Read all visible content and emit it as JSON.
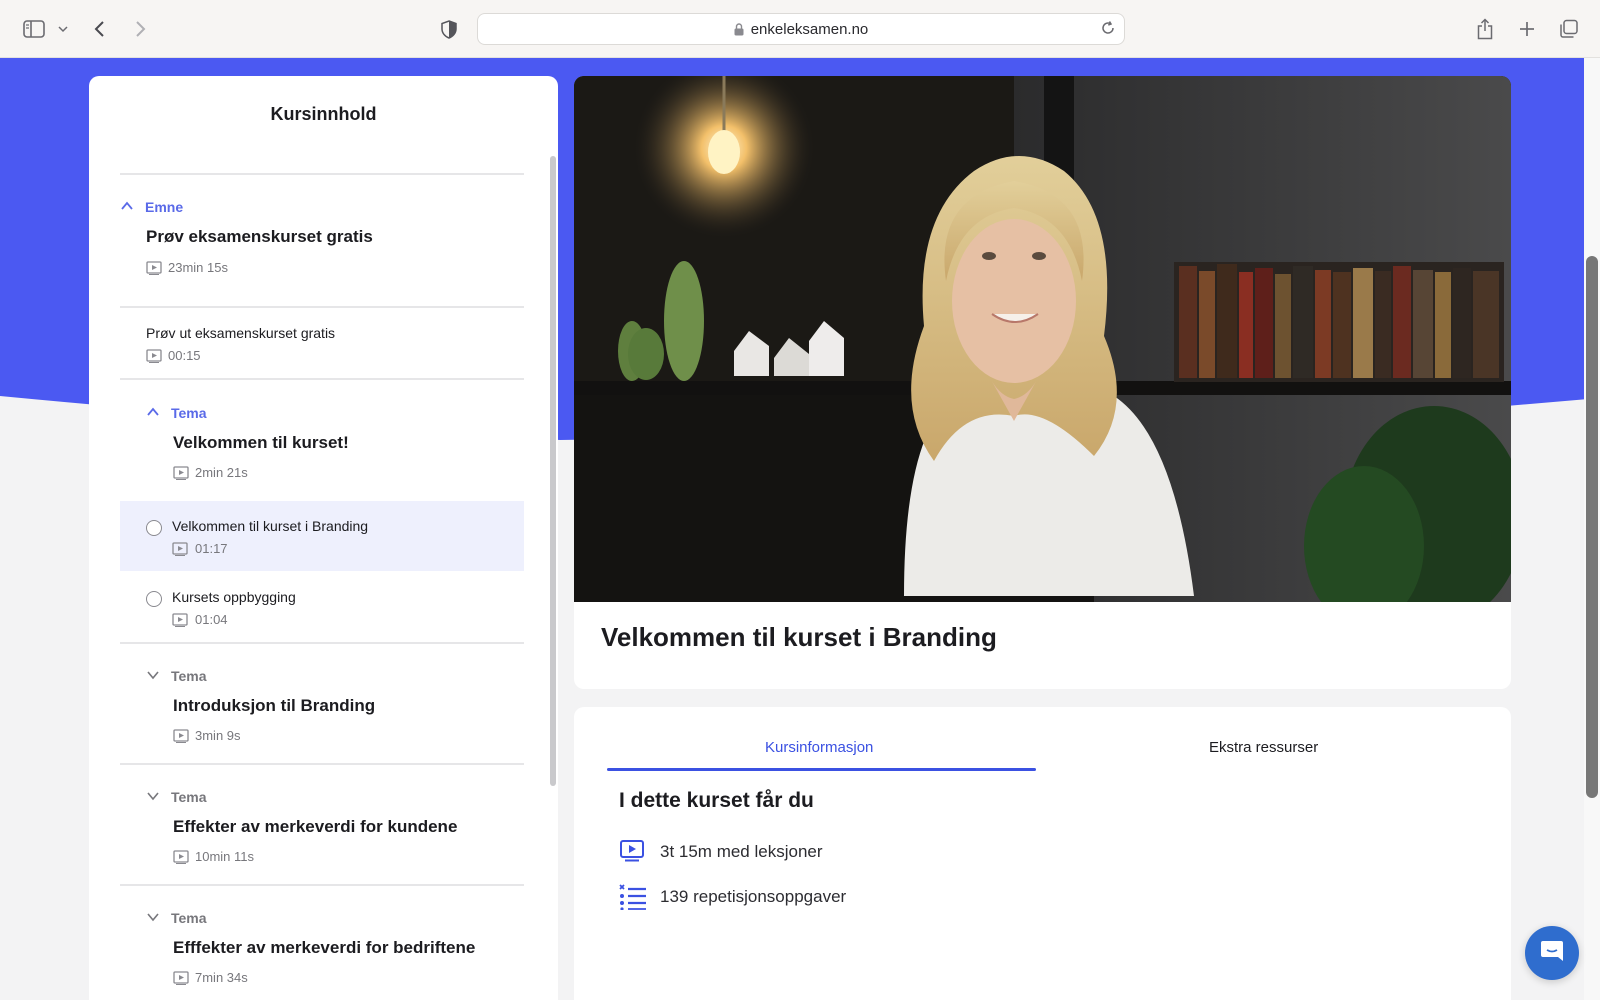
{
  "browser": {
    "url": "enkeleksamen.no",
    "icons": [
      "sidebar-icon",
      "chevron-down-icon",
      "back-icon",
      "forward-icon",
      "shield-icon",
      "lock-icon",
      "reload-icon",
      "share-icon",
      "new-tab-icon",
      "tabs-overview-icon"
    ]
  },
  "colors": {
    "brand_blue": "#4b59f2",
    "accent": "#3b51e2",
    "active_bg": "#eef0fd"
  },
  "sidebar": {
    "title": "Kursinnhold",
    "emne": {
      "label": "Emne",
      "title": "Prøv eksamenskurset gratis",
      "duration": "23min 15s",
      "lesson": {
        "title": "Prøv ut eksamenskurset gratis",
        "duration": "00:15"
      }
    },
    "tema_open": {
      "label": "Tema",
      "title": "Velkommen til kurset!",
      "duration": "2min 21s",
      "lessons": [
        {
          "title": "Velkommen til kurset i Branding",
          "duration": "01:17",
          "active": true
        },
        {
          "title": "Kursets oppbygging",
          "duration": "01:04",
          "active": false
        }
      ]
    },
    "tema_collapsed": [
      {
        "label": "Tema",
        "title": "Introduksjon til Branding",
        "duration": "3min 9s"
      },
      {
        "label": "Tema",
        "title": "Effekter av merkeverdi for kundene",
        "duration": "10min 11s"
      },
      {
        "label": "Tema",
        "title": "Efffekter av merkeverdi for bedriftene",
        "duration": "7min 34s"
      }
    ]
  },
  "video": {
    "title": "Velkommen til kurset i Branding"
  },
  "info": {
    "tabs": [
      {
        "label": "Kursinformasjon",
        "active": true
      },
      {
        "label": "Ekstra ressurser",
        "active": false
      }
    ],
    "heading": "I dette kurset får du",
    "rows": [
      {
        "icon": "video-play-icon",
        "text": "3t 15m  med leksjoner"
      },
      {
        "icon": "checklist-icon",
        "text": "139 repetisjonsoppgaver"
      }
    ]
  },
  "chat": {
    "icon": "chat-icon"
  }
}
